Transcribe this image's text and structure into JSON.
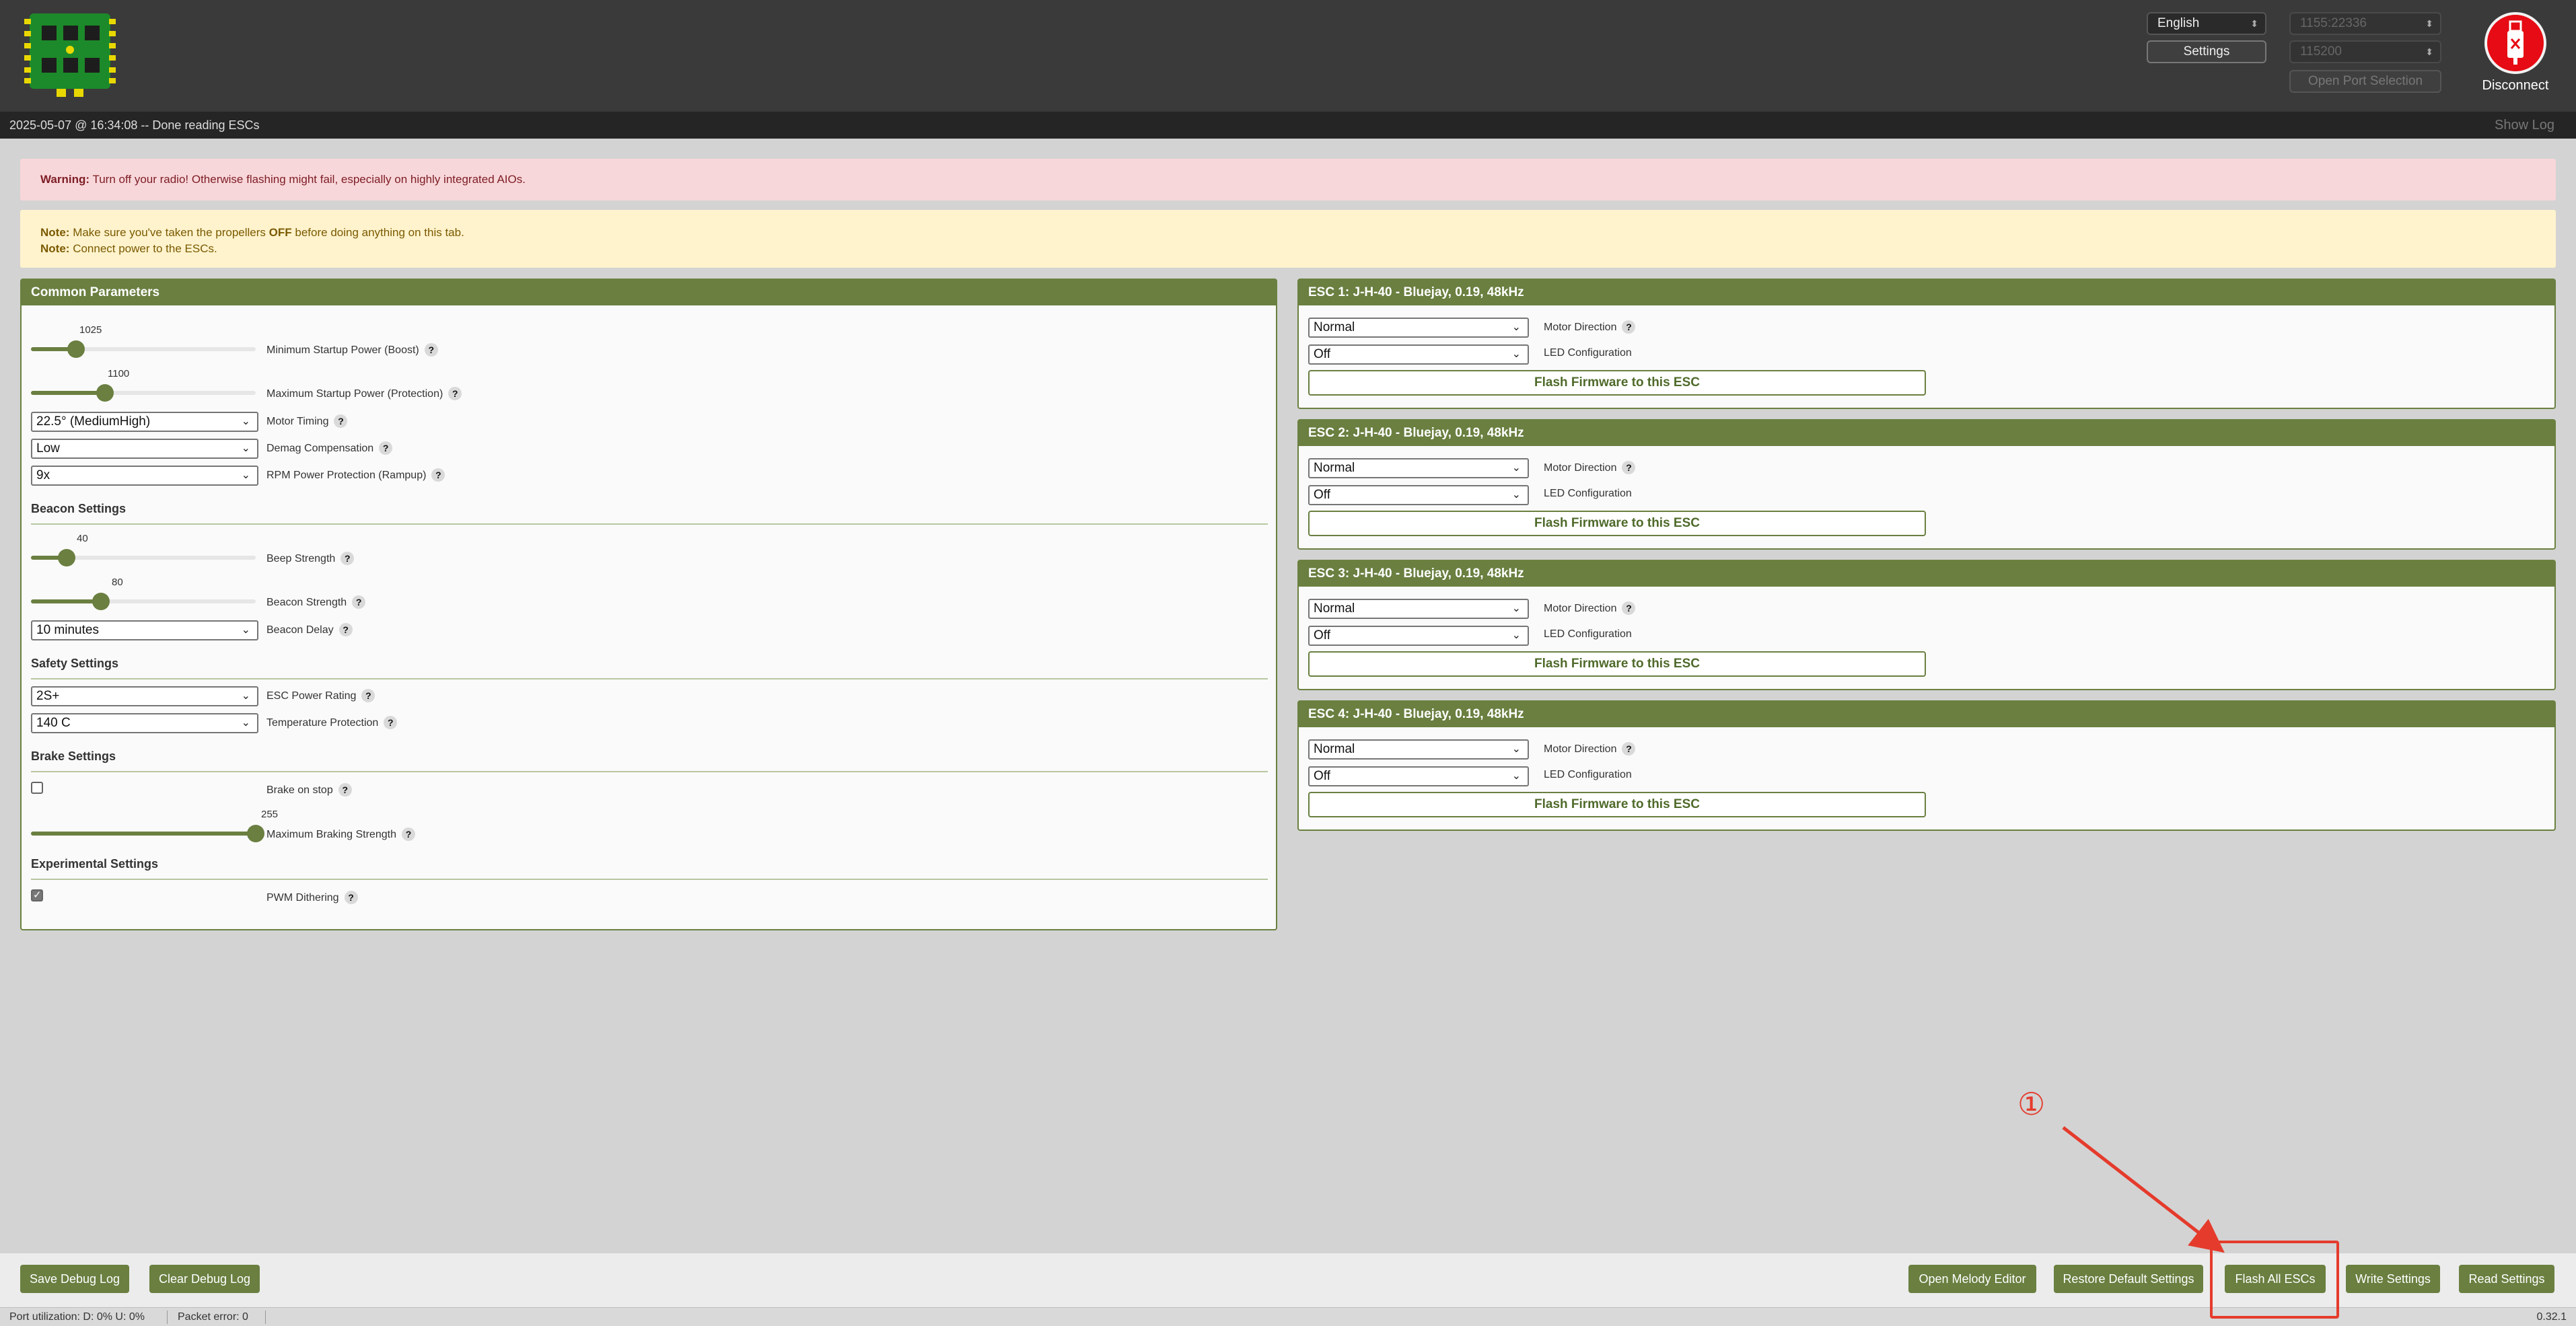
{
  "header": {
    "language": "English",
    "settings_label": "Settings",
    "port": "1155:22336",
    "baud": "115200",
    "open_port_selection": "Open Port Selection",
    "disconnect_label": "Disconnect"
  },
  "log": {
    "message": "2025-05-07 @ 16:34:08 -- Done reading ESCs",
    "show_log": "Show Log"
  },
  "notices": {
    "warning_prefix": "Warning:",
    "warning_text": "Turn off your radio! Otherwise flashing might fail, especially on highly integrated AIOs.",
    "note_prefix": "Note:",
    "note1_a": "Make sure you've taken the propellers",
    "note1_off": "OFF",
    "note1_b": "before doing anything on this tab.",
    "note2_text": "Connect power to the ESCs."
  },
  "common": {
    "title": "Common Parameters",
    "min_startup": {
      "label": "Minimum Startup Power (Boost)",
      "value": "1025",
      "fraction": 0.2
    },
    "max_startup": {
      "label": "Maximum Startup Power (Protection)",
      "value": "1100",
      "fraction": 0.33
    },
    "motor_timing": {
      "label": "Motor Timing",
      "value": "22.5° (MediumHigh)"
    },
    "demag": {
      "label": "Demag Compensation",
      "value": "Low"
    },
    "rpm_protection": {
      "label": "RPM Power Protection (Rampup)",
      "value": "9x"
    },
    "beacon_title": "Beacon Settings",
    "beep_strength": {
      "label": "Beep Strength",
      "value": "40",
      "fraction": 0.16
    },
    "beacon_strength": {
      "label": "Beacon Strength",
      "value": "80",
      "fraction": 0.31
    },
    "beacon_delay": {
      "label": "Beacon Delay",
      "value": "10 minutes"
    },
    "safety_title": "Safety Settings",
    "esc_power_rating": {
      "label": "ESC Power Rating",
      "value": "2S+"
    },
    "temp_protection": {
      "label": "Temperature Protection",
      "value": "140 C"
    },
    "brake_title": "Brake Settings",
    "brake_on_stop": {
      "label": "Brake on stop",
      "checked": false
    },
    "max_braking": {
      "label": "Maximum Braking Strength",
      "value": "255",
      "fraction": 1.0
    },
    "experimental_title": "Experimental Settings",
    "pwm_dithering": {
      "label": "PWM Dithering",
      "checked": true
    }
  },
  "escs": [
    {
      "title": "ESC 1: J-H-40 - Bluejay, 0.19, 48kHz",
      "direction": "Normal",
      "direction_label": "Motor Direction",
      "led": "Off",
      "led_label": "LED Configuration",
      "flash": "Flash Firmware to this ESC"
    },
    {
      "title": "ESC 2: J-H-40 - Bluejay, 0.19, 48kHz",
      "direction": "Normal",
      "direction_label": "Motor Direction",
      "led": "Off",
      "led_label": "LED Configuration",
      "flash": "Flash Firmware to this ESC"
    },
    {
      "title": "ESC 3: J-H-40 - Bluejay, 0.19, 48kHz",
      "direction": "Normal",
      "direction_label": "Motor Direction",
      "led": "Off",
      "led_label": "LED Configuration",
      "flash": "Flash Firmware to this ESC"
    },
    {
      "title": "ESC 4: J-H-40 - Bluejay, 0.19, 48kHz",
      "direction": "Normal",
      "direction_label": "Motor Direction",
      "led": "Off",
      "led_label": "LED Configuration",
      "flash": "Flash Firmware to this ESC"
    }
  ],
  "bottom": {
    "save_debug": "Save Debug Log",
    "clear_debug": "Clear Debug Log",
    "melody_editor": "Open Melody Editor",
    "restore_defaults": "Restore Default Settings",
    "flash_all": "Flash All ESCs",
    "write_settings": "Write Settings",
    "read_settings": "Read Settings"
  },
  "status": {
    "port_util": "Port utilization: D: 0% U: 0%",
    "packet_error": "Packet error: 0",
    "version": "0.32.1"
  },
  "annotation": {
    "number": "①"
  },
  "colors": {
    "accent": "#6a7f40",
    "annotation": "#e53b2c",
    "disconnect": "#e60b14"
  }
}
